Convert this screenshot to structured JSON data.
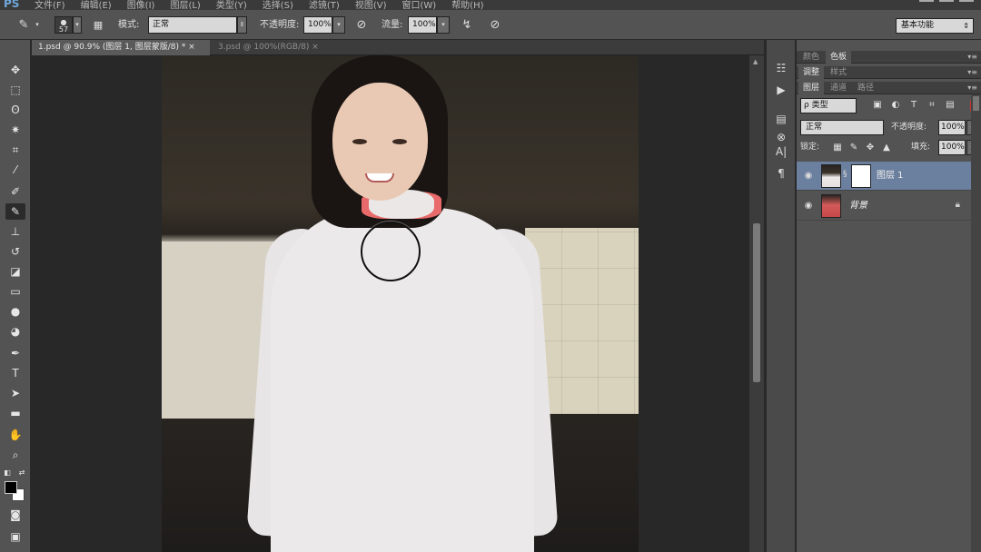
{
  "app": {
    "logo": "PS",
    "menu": [
      "文件(F)",
      "编辑(E)",
      "图像(I)",
      "图层(L)",
      "类型(Y)",
      "选择(S)",
      "滤镜(T)",
      "视图(V)",
      "窗口(W)",
      "帮助(H)"
    ]
  },
  "options": {
    "brush_size": "57",
    "mode_label": "模式:",
    "mode_value": "正常",
    "opacity_label": "不透明度:",
    "opacity_value": "100%",
    "flow_label": "流量:",
    "flow_value": "100%",
    "workspace": "基本功能"
  },
  "documents": [
    {
      "title": "1.psd @ 90.9% (图层 1, 图层蒙版/8) *",
      "close": "×"
    },
    {
      "title": "3.psd @ 100%(RGB/8)",
      "close": "×"
    }
  ],
  "panels": {
    "group1_tabs": [
      "颜色",
      "色板"
    ],
    "group2_tabs": [
      "调整",
      "样式"
    ],
    "group3_tabs": [
      "图层",
      "通道",
      "路径"
    ],
    "menu_glyph": "▾≡",
    "filter_kind": "ρ 类型",
    "blend_mode": "正常",
    "opacity_label": "不透明度:",
    "opacity_value": "100%",
    "lock_label": "锁定:",
    "fill_label": "填充:",
    "fill_value": "100%",
    "layers": [
      {
        "name": "图层 1",
        "selected": true,
        "has_mask": true
      },
      {
        "name": "背景",
        "selected": false,
        "locked": true
      }
    ]
  },
  "colors": {
    "accent_selection": "#6b7f9e",
    "foreground": "#000000",
    "background": "#ffffff"
  }
}
